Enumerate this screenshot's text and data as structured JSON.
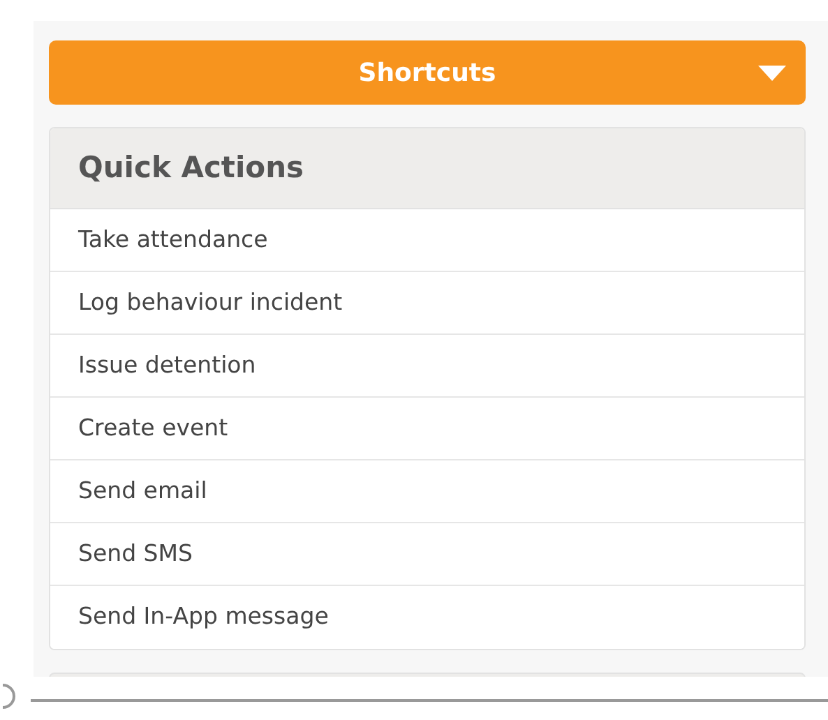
{
  "shortcuts_button": {
    "label": "Shortcuts",
    "expanded": true
  },
  "quick_actions": {
    "title": "Quick Actions",
    "items": [
      {
        "label": "Take attendance"
      },
      {
        "label": "Log behaviour incident"
      },
      {
        "label": "Issue detention"
      },
      {
        "label": "Create event"
      },
      {
        "label": "Send email"
      },
      {
        "label": "Send SMS"
      },
      {
        "label": "Send In-App message"
      }
    ]
  }
}
